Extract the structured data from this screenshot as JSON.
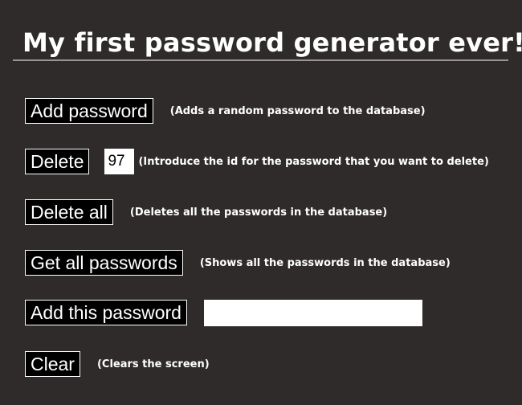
{
  "page": {
    "title": "My first password generator ever!"
  },
  "actions": {
    "add_password": {
      "label": "Add password",
      "hint": "(Adds a random password to the database)"
    },
    "delete": {
      "label": "Delete",
      "id_value": "97",
      "hint": "(Introduce the id for the password that you want to delete)"
    },
    "delete_all": {
      "label": "Delete all",
      "hint": "(Deletes all the passwords in the database)"
    },
    "get_all": {
      "label": "Get all passwords",
      "hint": "(Shows all the passwords in the database)"
    },
    "add_this": {
      "label": "Add this password",
      "input_value": ""
    },
    "clear": {
      "label": "Clear",
      "hint": "(Clears the screen)"
    }
  },
  "colors": {
    "background": "#2f2b2b",
    "text": "#ffffff",
    "button_bg": "#000000",
    "rule": "#9a9696"
  }
}
